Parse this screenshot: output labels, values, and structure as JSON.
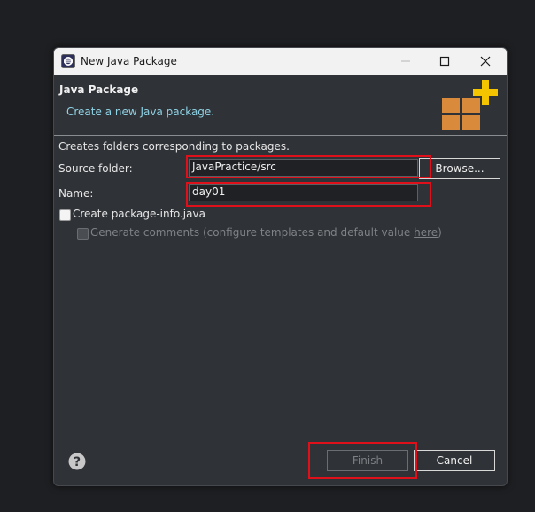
{
  "window": {
    "title": "New Java Package"
  },
  "banner": {
    "title": "Java Package",
    "description": "Create a new Java package."
  },
  "form": {
    "intro": "Creates folders corresponding to packages.",
    "source_folder_label": "Source folder:",
    "source_folder_value": "JavaPractice/src",
    "browse_label": "Browse...",
    "name_label": "Name:",
    "name_value": "day01",
    "create_package_info_label": "Create package-info.java",
    "generate_comments_label": "Generate comments",
    "generate_comments_hint": "(configure templates and default value ",
    "here_link": "here",
    "hint_close": ")"
  },
  "footer": {
    "finish_label": "Finish",
    "cancel_label": "Cancel"
  },
  "colors": {
    "highlight": "#e0101a",
    "banner_desc": "#8fd3e6",
    "package_icon_orange": "#d98a3a",
    "package_icon_plus": "#f5c400"
  }
}
